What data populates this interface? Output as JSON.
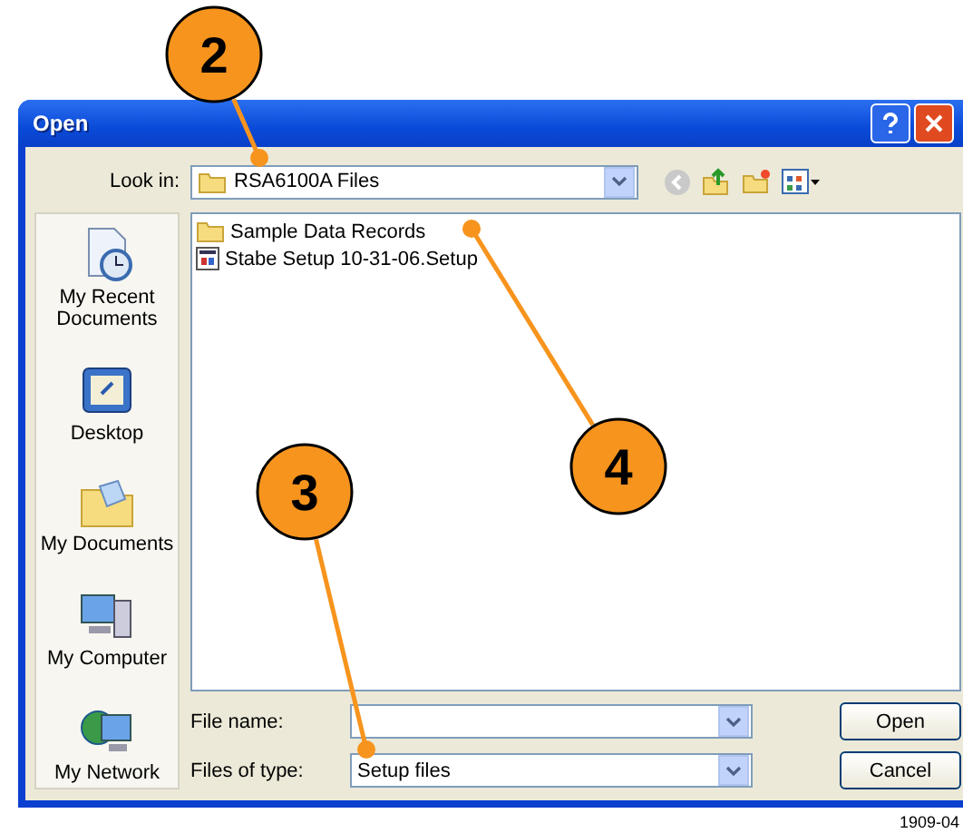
{
  "window": {
    "title": "Open"
  },
  "look_in": {
    "label": "Look in:",
    "value": "RSA6100A Files"
  },
  "places": [
    {
      "label": "My Recent Documents",
      "kind": "recent"
    },
    {
      "label": "Desktop",
      "kind": "desktop"
    },
    {
      "label": "My Documents",
      "kind": "documents"
    },
    {
      "label": "My Computer",
      "kind": "computer"
    },
    {
      "label": "My Network",
      "kind": "network"
    }
  ],
  "files": [
    {
      "name": "Sample Data Records",
      "kind": "folder"
    },
    {
      "name": "Stabe Setup 10-31-06.Setup",
      "kind": "setup"
    }
  ],
  "file_name": {
    "label": "File name:"
  },
  "file_type": {
    "label": "Files of type:",
    "value": "Setup files"
  },
  "buttons": [
    "Open",
    "Cancel"
  ],
  "callouts": [
    {
      "number": "2"
    },
    {
      "number": "3"
    },
    {
      "number": "4"
    }
  ],
  "figure_id": "1909-04"
}
